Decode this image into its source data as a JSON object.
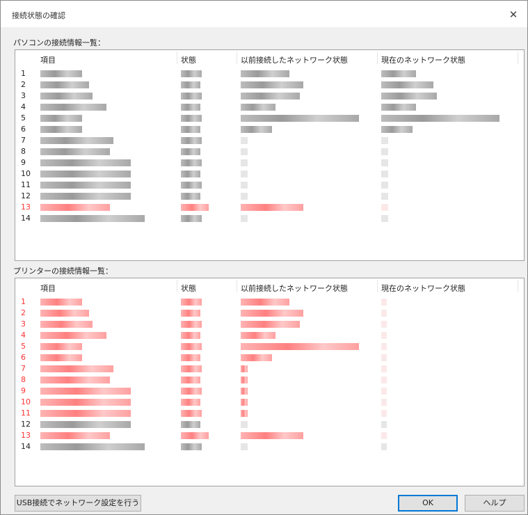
{
  "window": {
    "title": "接続状態の確認",
    "close_icon": "close-icon"
  },
  "pc_list": {
    "label": "パソコンの接続情報一覧：",
    "columns": [
      "項目",
      "状態",
      "以前接続したネットワーク状態",
      "現在のネットワーク状態"
    ],
    "rows": [
      {
        "num": "1",
        "highlight": false
      },
      {
        "num": "2",
        "highlight": false
      },
      {
        "num": "3",
        "highlight": false
      },
      {
        "num": "4",
        "highlight": false
      },
      {
        "num": "5",
        "highlight": false
      },
      {
        "num": "6",
        "highlight": false
      },
      {
        "num": "7",
        "highlight": false
      },
      {
        "num": "8",
        "highlight": false
      },
      {
        "num": "9",
        "highlight": false
      },
      {
        "num": "10",
        "highlight": false
      },
      {
        "num": "11",
        "highlight": false
      },
      {
        "num": "12",
        "highlight": false
      },
      {
        "num": "13",
        "highlight": true
      },
      {
        "num": "14",
        "highlight": false
      }
    ]
  },
  "printer_list": {
    "label": "プリンターの接続情報一覧：",
    "columns": [
      "項目",
      "状態",
      "以前接続したネットワーク状態",
      "現在のネットワーク状態"
    ],
    "rows": [
      {
        "num": "1",
        "highlight": true
      },
      {
        "num": "2",
        "highlight": true
      },
      {
        "num": "3",
        "highlight": true
      },
      {
        "num": "4",
        "highlight": true
      },
      {
        "num": "5",
        "highlight": true
      },
      {
        "num": "6",
        "highlight": true
      },
      {
        "num": "7",
        "highlight": true
      },
      {
        "num": "8",
        "highlight": true
      },
      {
        "num": "9",
        "highlight": true
      },
      {
        "num": "10",
        "highlight": true
      },
      {
        "num": "11",
        "highlight": true
      },
      {
        "num": "12",
        "highlight": false
      },
      {
        "num": "13",
        "highlight": true
      },
      {
        "num": "14",
        "highlight": false
      }
    ]
  },
  "buttons": {
    "usb_setup": "USB接続でネットワーク設定を行う",
    "ok": "OK",
    "help": "ヘルプ"
  },
  "colors": {
    "highlight": "#ff3333",
    "normal": "#222222"
  }
}
